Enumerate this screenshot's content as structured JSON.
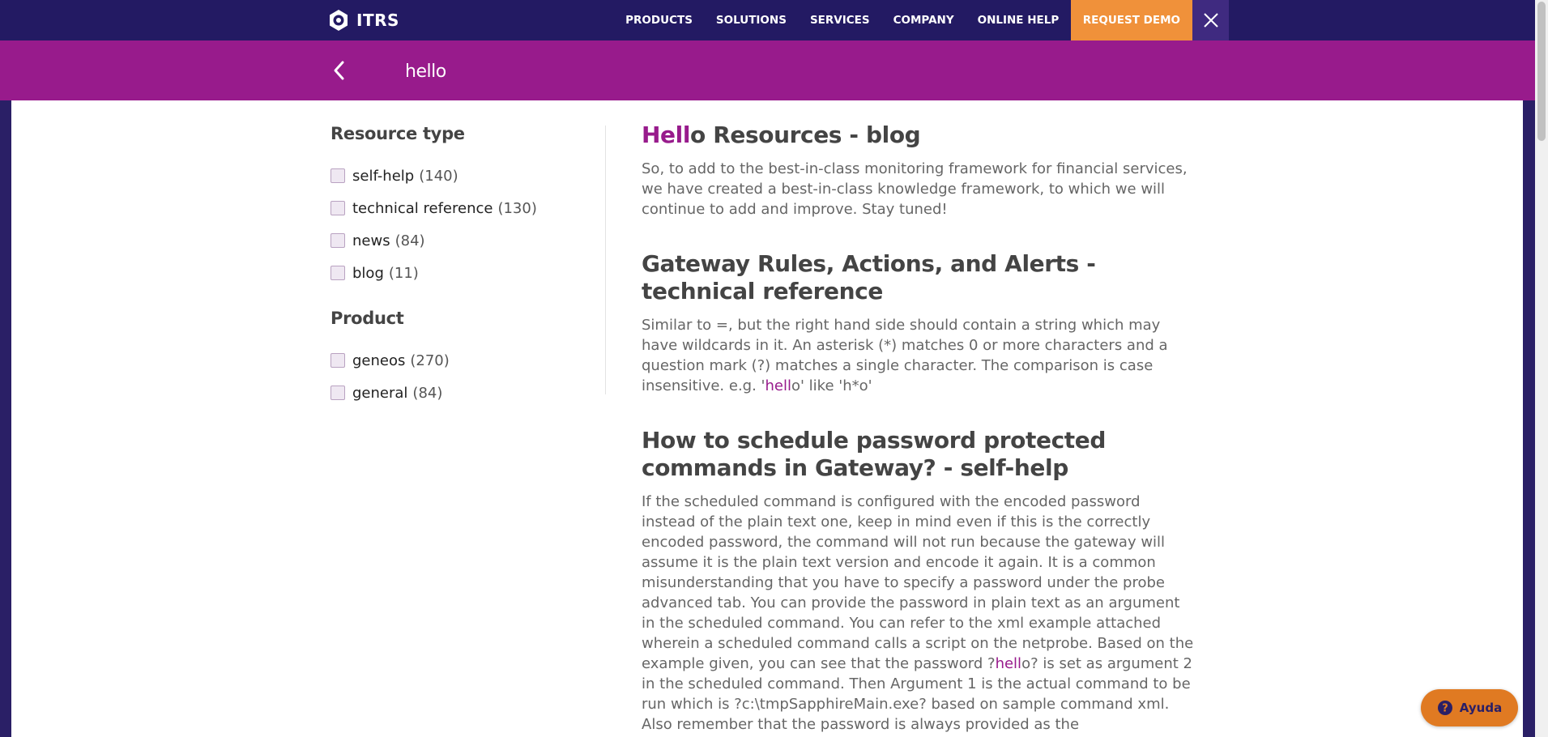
{
  "brand": {
    "name": "ITRS"
  },
  "nav": {
    "items": [
      "PRODUCTS",
      "SOLUTIONS",
      "SERVICES",
      "COMPANY",
      "ONLINE HELP"
    ],
    "demo_label": "REQUEST DEMO"
  },
  "search": {
    "value": "hello",
    "placeholder": ""
  },
  "filters": {
    "resource_type": {
      "heading": "Resource type",
      "items": [
        {
          "label": "self-help",
          "count": "(140)"
        },
        {
          "label": "technical reference",
          "count": "(130)"
        },
        {
          "label": "news",
          "count": "(84)"
        },
        {
          "label": "blog",
          "count": "(11)"
        }
      ]
    },
    "product": {
      "heading": "Product",
      "items": [
        {
          "label": "geneos",
          "count": "(270)"
        },
        {
          "label": "general",
          "count": "(84)"
        }
      ]
    }
  },
  "results": [
    {
      "title_hl": "Hell",
      "title_rest": "o Resources - blog",
      "body": "So, to add to the best-in-class monitoring framework for financial services, we have created a best-in-class knowledge framework, to which we will continue to add and improve. Stay tuned!"
    },
    {
      "title": "Gateway Rules, Actions, and Alerts - technical reference",
      "body_pre": "Similar to =, but the right hand side should contain a string which may have wildcards in it. An asterisk (*) matches 0 or more characters and a question mark (?) matches a single character. The comparison is case insensitive. e.g. '",
      "body_hl": "hell",
      "body_post": "o' like 'h*o'"
    },
    {
      "title": "How to schedule password protected commands in Gateway? - self-help",
      "body_pre": "If the scheduled command is configured with the encoded password instead of the plain text one, keep in mind even if this is the correctly encoded password, the command will not run because the gateway will assume it is the plain text version and encode it again. It is a common misunderstanding that you have to specify a password under the probe advanced tab. You can provide the password in plain text as an argument in the scheduled command. You can refer to the xml example attached wherein a scheduled command calls a script on the netprobe. Based on the example given, you can see that the password ?",
      "body_hl": "hell",
      "body_post": "o? is set as argument 2 in the scheduled command. Then Argument 1 is the actual command to be run which is ?c:\\tmpSapphireMain.exe? based on sample command xml. Also remember that the password is always provided as the"
    }
  ],
  "help": {
    "label": "Ayuda"
  },
  "colors": {
    "navy": "#231a63",
    "magenta": "#981b8c",
    "orange": "#f0913a",
    "help_orange": "#e07a22"
  },
  "icons": [
    "itrs-logo-icon",
    "close-icon",
    "back-arrow-icon",
    "question-icon"
  ]
}
